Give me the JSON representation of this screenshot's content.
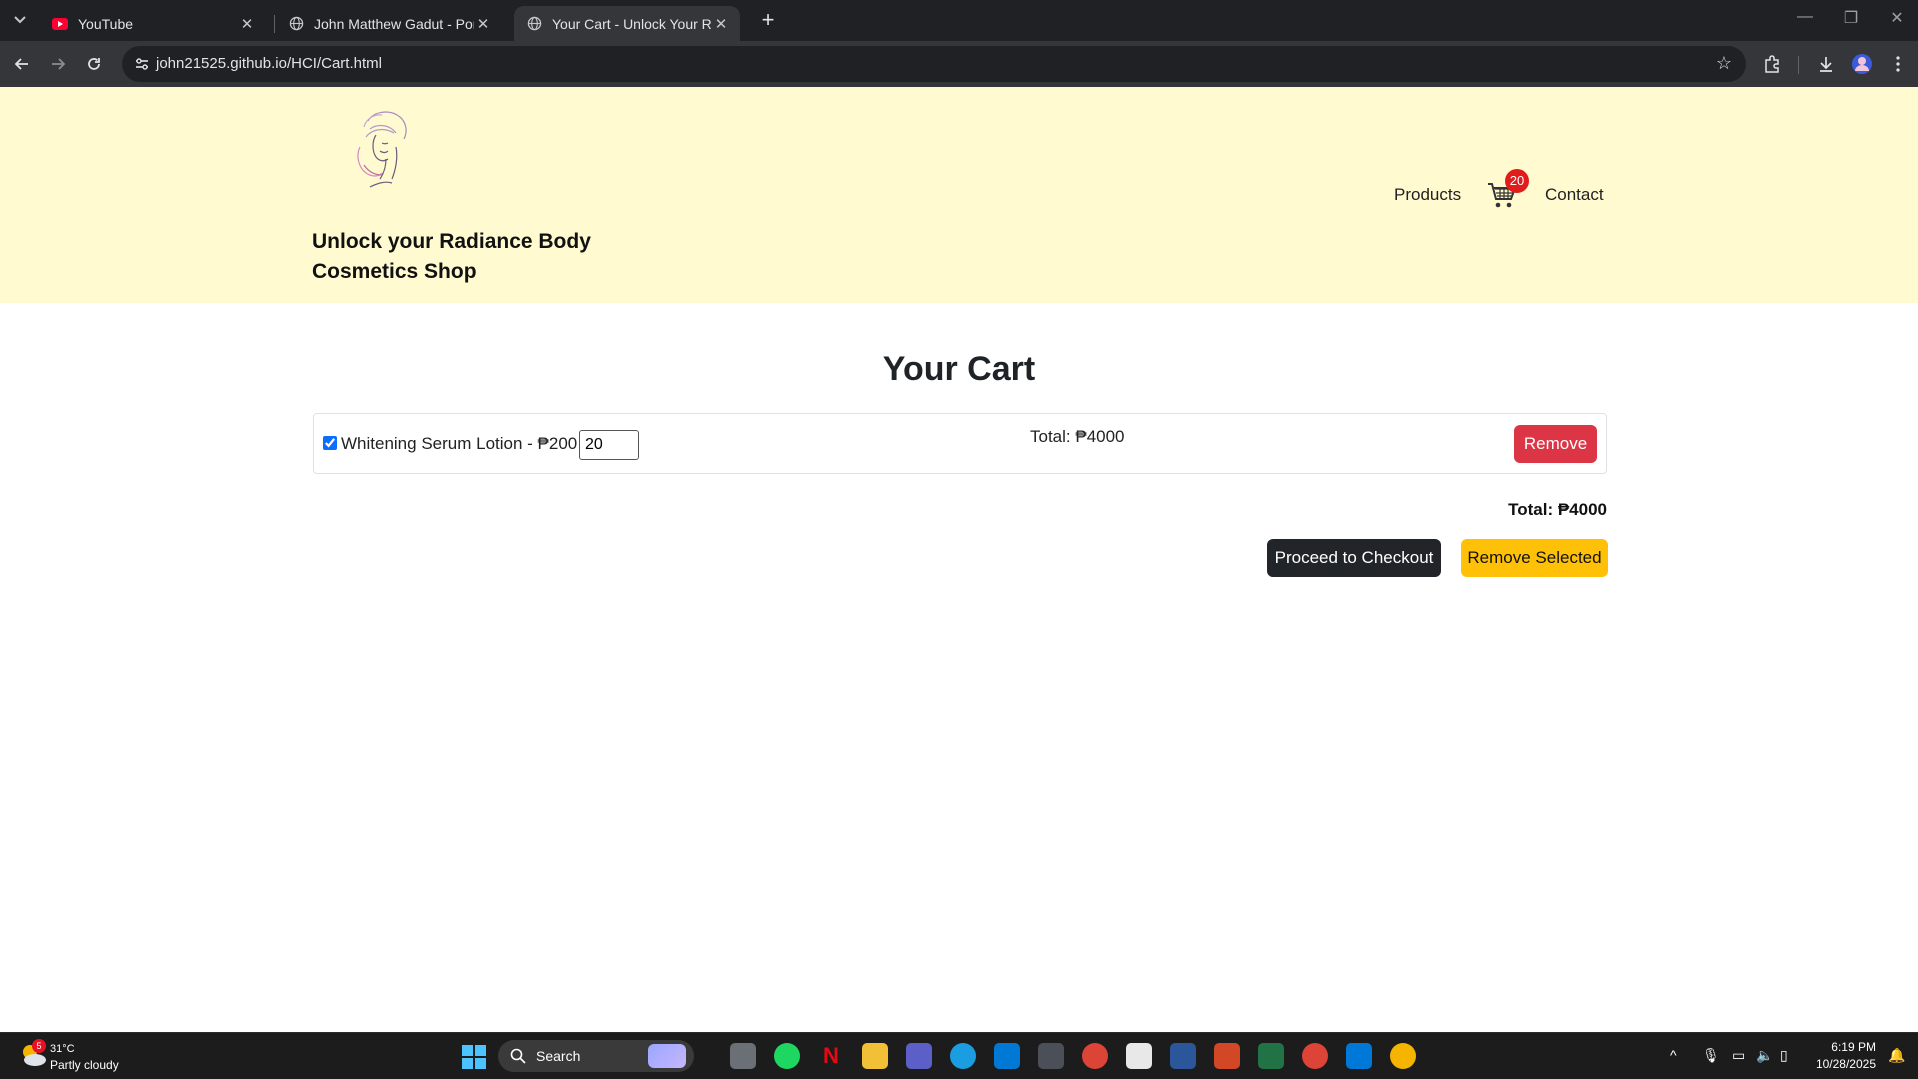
{
  "browser": {
    "tabs": [
      {
        "title": "YouTube",
        "favicon": "youtube-icon",
        "active": false
      },
      {
        "title": "John Matthew Gadut - Portfolio",
        "favicon": "globe-icon",
        "active": false
      },
      {
        "title": "Your Cart - Unlock Your Radiance",
        "favicon": "globe-icon",
        "active": true
      }
    ],
    "url": "john21525.github.io/HCI/Cart.html"
  },
  "header": {
    "brand_line1": "Unlock your Radiance Body",
    "brand_line2": "Cosmetics Shop",
    "nav_products": "Products",
    "cart_count": "20",
    "nav_contact": "Contact"
  },
  "cart": {
    "title": "Your Cart",
    "items": [
      {
        "checked": true,
        "name": "Whitening Serum Lotion - ₱200 x",
        "quantity": "20",
        "total": "Total: ₱4000",
        "remove_label": "Remove"
      }
    ],
    "grand_total": "Total: ₱4000",
    "checkout_label": "Proceed to Checkout",
    "remove_selected_label": "Remove Selected"
  },
  "colors": {
    "header_bg": "#fffad0",
    "remove": "#dc3545",
    "checkout": "#212529",
    "remove_selected": "#ffc107",
    "badge": "#e21b1b"
  },
  "taskbar": {
    "weather_badge": "5",
    "temperature": "31°C",
    "weather": "Partly cloudy",
    "search_label": "Search",
    "time": "6:19 PM",
    "date": "10/28/2025"
  }
}
